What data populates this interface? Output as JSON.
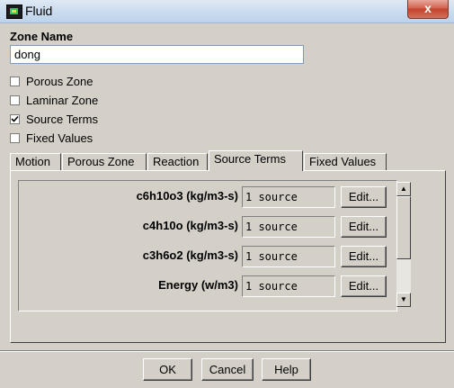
{
  "window": {
    "title": "Fluid",
    "close_label": "x"
  },
  "zone": {
    "label": "Zone Name",
    "value": "dong"
  },
  "options": [
    {
      "label": "Porous Zone",
      "checked": false
    },
    {
      "label": "Laminar Zone",
      "checked": false
    },
    {
      "label": "Source Terms",
      "checked": true
    },
    {
      "label": "Fixed Values",
      "checked": false
    }
  ],
  "tabs": [
    "Motion",
    "Porous Zone",
    "Reaction",
    "Source Terms",
    "Fixed Values"
  ],
  "active_tab": "Source Terms",
  "source_rows": [
    {
      "label": "c6h10o3 (kg/m3-s)",
      "value": "1 source",
      "button": "Edit..."
    },
    {
      "label": "c4h10o (kg/m3-s)",
      "value": "1 source",
      "button": "Edit..."
    },
    {
      "label": "c3h6o2 (kg/m3-s)",
      "value": "1 source",
      "button": "Edit..."
    },
    {
      "label": "Energy (w/m3)",
      "value": "1 source",
      "button": "Edit..."
    }
  ],
  "scroll_arrows": {
    "up": "▲",
    "down": "▼"
  },
  "buttons": {
    "ok": "OK",
    "cancel": "Cancel",
    "help": "Help"
  }
}
